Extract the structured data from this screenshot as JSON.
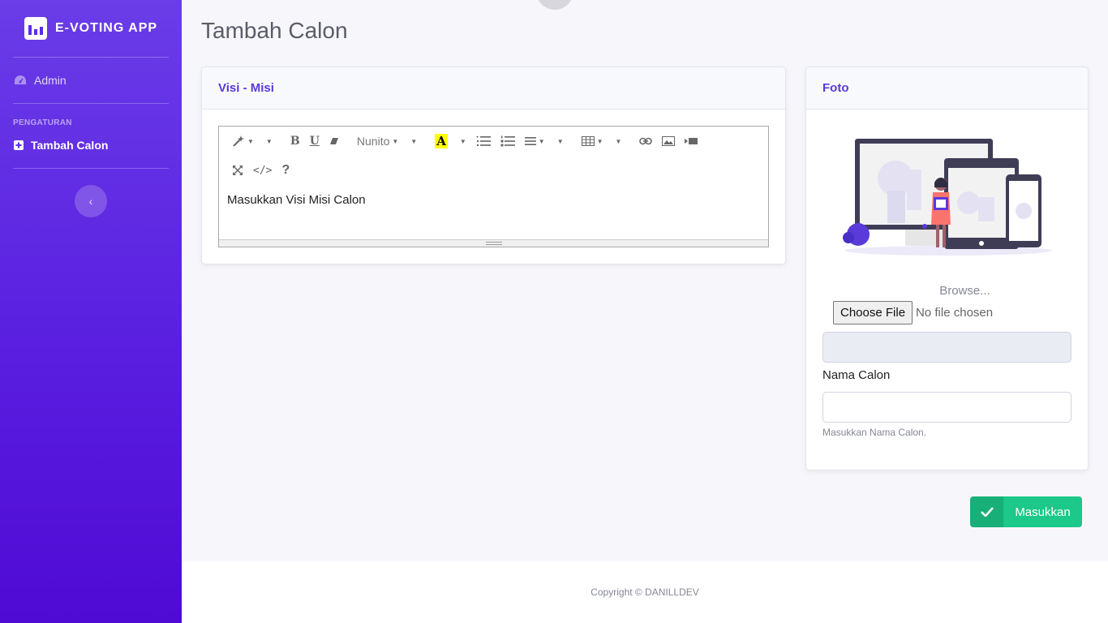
{
  "brand": {
    "name": "E-VOTING APP",
    "icon": "bar-chart-icon"
  },
  "sidebar": {
    "items": [
      {
        "label": "Admin",
        "icon": "tachometer-icon"
      }
    ],
    "heading": "PENGATURAN",
    "section_items": [
      {
        "label": "Tambah Calon",
        "icon": "plus-square-icon",
        "active": true
      }
    ],
    "toggle_icon": "chevron-left-icon"
  },
  "page": {
    "title": "Tambah Calon"
  },
  "visi_card": {
    "title": "Visi - Misi",
    "editor": {
      "font_name": "Nunito",
      "color_button": "A",
      "content": "Masukkan Visi Misi Calon",
      "help_icon": "?"
    }
  },
  "foto_card": {
    "title": "Foto",
    "browse_label": "Browse...",
    "file_button": "Choose File",
    "file_status": "No file chosen",
    "name_label": "Nama Calon",
    "name_value": "",
    "name_help": "Masukkan Nama Calon."
  },
  "submit": {
    "label": "Masukkan",
    "icon": "check-icon"
  },
  "footer": {
    "text": "Copyright © DANILLDEV"
  },
  "colors": {
    "sidebar_top": "#6a3de8",
    "sidebar_bottom": "#4f0ad4",
    "accent": "#5a3ad8",
    "success": "#1cc88a",
    "background": "#f7f7fb"
  }
}
